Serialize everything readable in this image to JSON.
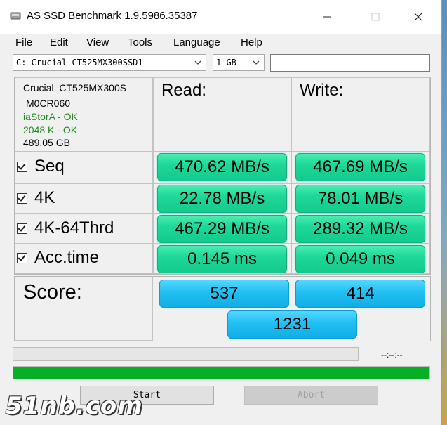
{
  "window": {
    "title": "AS SSD Benchmark 1.9.5986.35387"
  },
  "menu": [
    "File",
    "Edit",
    "View",
    "Tools",
    "Language",
    "Help"
  ],
  "drive_select": {
    "value": "C: Crucial_CT525MX300SSD1"
  },
  "size_select": {
    "value": "1 GB"
  },
  "drive_info": {
    "model": "Crucial_CT525MX300S",
    "firmware": "M0CR060",
    "driver": "iaStorA - OK",
    "alignment": "2048 K - OK",
    "capacity": "489.05 GB"
  },
  "headers": {
    "read": "Read:",
    "write": "Write:"
  },
  "tests": [
    {
      "label": "Seq",
      "checked": true,
      "read": "470.62 MB/s",
      "write": "467.69 MB/s"
    },
    {
      "label": "4K",
      "checked": true,
      "read": "22.78 MB/s",
      "write": "78.01 MB/s"
    },
    {
      "label": "4K-64Thrd",
      "checked": true,
      "read": "467.29 MB/s",
      "write": "289.32 MB/s"
    },
    {
      "label": "Acc.time",
      "checked": true,
      "read": "0.145 ms",
      "write": "0.049 ms"
    }
  ],
  "score": {
    "label": "Score:",
    "read": "537",
    "write": "414",
    "total": "1231"
  },
  "progress": {
    "time": "--:--:--",
    "test_progress": 0.0,
    "overall_progress": 1.0
  },
  "buttons": {
    "start": "Start",
    "abort": "Abort"
  },
  "watermark": "51nb.com",
  "colors": {
    "result_green": "#1ed89a",
    "score_blue": "#22bff2",
    "progress_green": "#06b025"
  }
}
